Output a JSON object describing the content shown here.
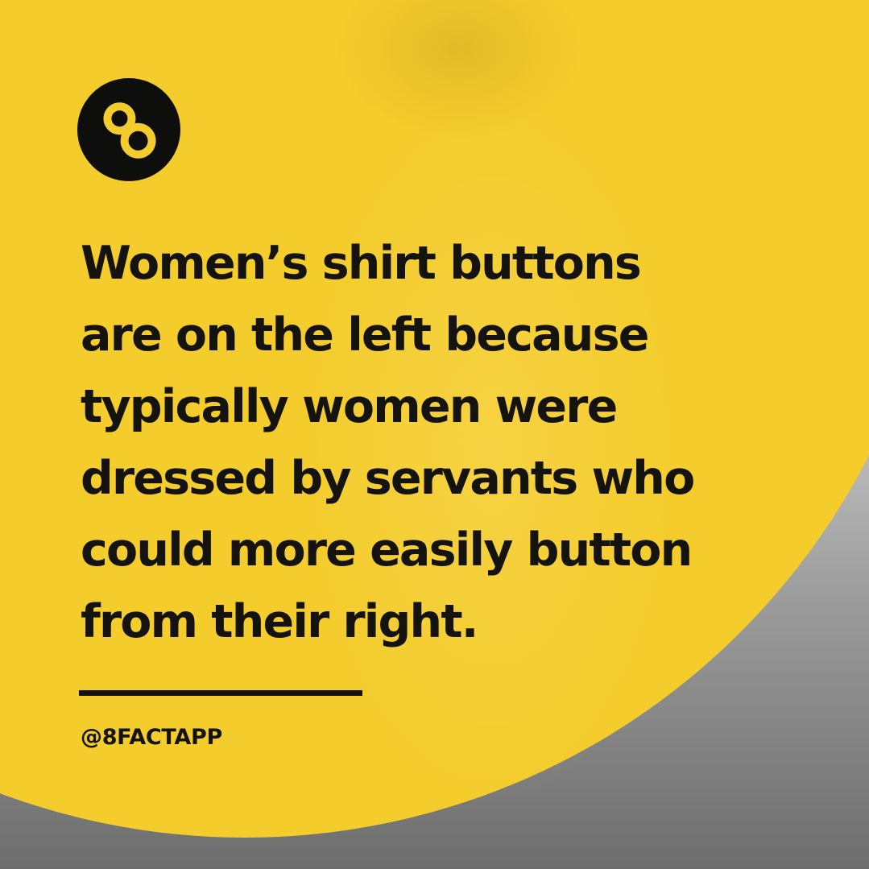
{
  "brand": {
    "logo_icon": "figure-eight-icon",
    "handle": "@8FACTAPP",
    "accent_color": "#f4cc2c",
    "text_color": "#15130d"
  },
  "fact": {
    "lines": [
      "Women’s shirt buttons",
      "are on the left because",
      "typically women were",
      "dressed by servants who",
      "could more easily button",
      "from their right."
    ]
  }
}
